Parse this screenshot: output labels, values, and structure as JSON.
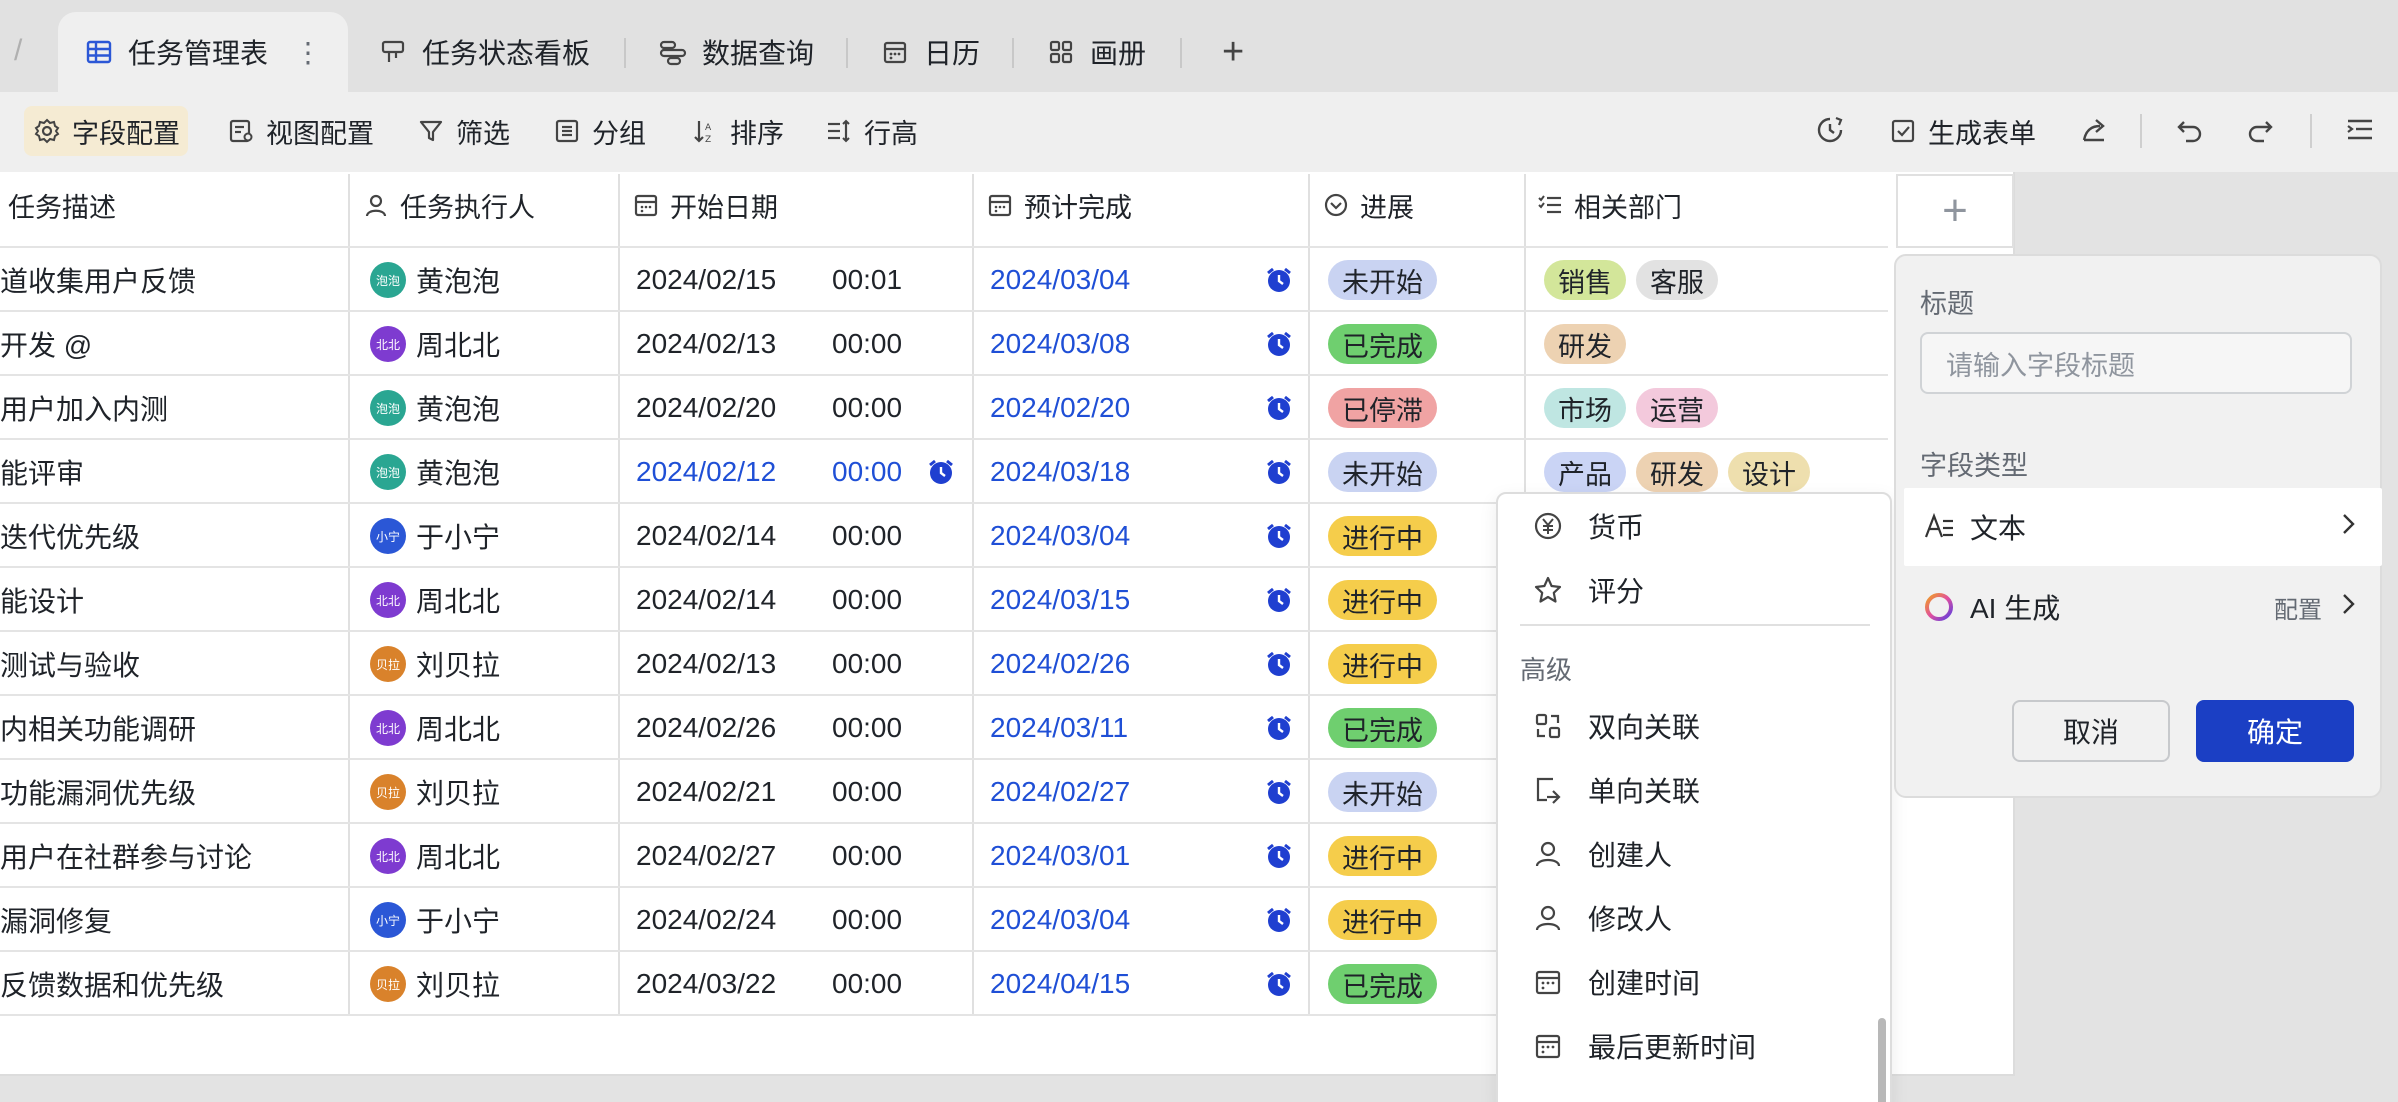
{
  "tabs": {
    "active": "任务管理表",
    "items": [
      "任务状态看板",
      "数据查询",
      "日历",
      "画册"
    ]
  },
  "toolbar": {
    "items": [
      "字段配置",
      "视图配置",
      "筛选",
      "分组",
      "排序",
      "行高"
    ],
    "generate_form": "生成表单"
  },
  "columns": [
    "任务描述",
    "任务执行人",
    "开始日期",
    "预计完成",
    "进展",
    "相关部门"
  ],
  "rows": [
    {
      "desc": "道收集用户反馈",
      "avatar": "泡泡",
      "avatar_color": "#2aa692",
      "person": "黄泡泡",
      "start_date": "2024/02/15",
      "start_time": "00:01",
      "due": "2024/03/04",
      "status": "未开始",
      "depts": [
        "销售",
        "客服"
      ]
    },
    {
      "desc": "开发 @",
      "avatar": "北北",
      "avatar_color": "#7e3bd0",
      "person": "周北北",
      "start_date": "2024/02/13",
      "start_time": "00:00",
      "due": "2024/03/08",
      "status": "已完成",
      "depts": [
        "研发"
      ]
    },
    {
      "desc": "用户加入内测",
      "avatar": "泡泡",
      "avatar_color": "#2aa692",
      "person": "黄泡泡",
      "start_date": "2024/02/20",
      "start_time": "00:00",
      "due": "2024/02/20",
      "status": "已停滞",
      "depts": [
        "市场",
        "运营"
      ]
    },
    {
      "desc": "能评审",
      "avatar": "泡泡",
      "avatar_color": "#2aa692",
      "person": "黄泡泡",
      "start_date": "2024/02/12",
      "start_time": "00:00",
      "due": "2024/03/18",
      "status": "未开始",
      "depts": [
        "产品",
        "研发",
        "设计"
      ]
    },
    {
      "desc": "迭代优先级",
      "avatar": "小宁",
      "avatar_color": "#2b57d6",
      "person": "于小宁",
      "start_date": "2024/02/14",
      "start_time": "00:00",
      "due": "2024/03/04",
      "status": "进行中",
      "depts": []
    },
    {
      "desc": "能设计",
      "avatar": "北北",
      "avatar_color": "#7e3bd0",
      "person": "周北北",
      "start_date": "2024/02/14",
      "start_time": "00:00",
      "due": "2024/03/15",
      "status": "进行中",
      "depts": []
    },
    {
      "desc": "测试与验收",
      "avatar": "贝拉",
      "avatar_color": "#d9822b",
      "person": "刘贝拉",
      "start_date": "2024/02/13",
      "start_time": "00:00",
      "due": "2024/02/26",
      "status": "进行中",
      "depts": []
    },
    {
      "desc": "内相关功能调研",
      "avatar": "北北",
      "avatar_color": "#7e3bd0",
      "person": "周北北",
      "start_date": "2024/02/26",
      "start_time": "00:00",
      "due": "2024/03/11",
      "status": "已完成",
      "depts": []
    },
    {
      "desc": "功能漏洞优先级",
      "avatar": "贝拉",
      "avatar_color": "#d9822b",
      "person": "刘贝拉",
      "start_date": "2024/02/21",
      "start_time": "00:00",
      "due": "2024/02/27",
      "status": "未开始",
      "depts": []
    },
    {
      "desc": "用户在社群参与讨论",
      "avatar": "北北",
      "avatar_color": "#7e3bd0",
      "person": "周北北",
      "start_date": "2024/02/27",
      "start_time": "00:00",
      "due": "2024/03/01",
      "status": "进行中",
      "depts": []
    },
    {
      "desc": "漏洞修复",
      "avatar": "小宁",
      "avatar_color": "#2b57d6",
      "person": "于小宁",
      "start_date": "2024/02/24",
      "start_time": "00:00",
      "due": "2024/03/04",
      "status": "进行中",
      "depts": []
    },
    {
      "desc": "反馈数据和优先级",
      "avatar": "贝拉",
      "avatar_color": "#d9822b",
      "person": "刘贝拉",
      "start_date": "2024/03/22",
      "start_time": "00:00",
      "due": "2024/04/15",
      "status": "已完成",
      "depts": []
    }
  ],
  "status_colors": {
    "未开始": "#c9d3f2",
    "已完成": "#6fcf6f",
    "已停滞": "#f0a3a3",
    "进行中": "#f5cd4b"
  },
  "dept_colors": {
    "销售": "#d3e69a",
    "客服": "#e2e2e2",
    "研发": "#edd2b2",
    "市场": "#bfe6e2",
    "运营": "#f3c9dc",
    "产品": "#cad4f5",
    "设计": "#eedfae"
  },
  "field_menu": {
    "items_top": [
      "货币",
      "评分"
    ],
    "group_label": "高级",
    "items_advanced": [
      "双向关联",
      "单向关联",
      "创建人",
      "修改人",
      "创建时间",
      "最后更新时间"
    ]
  },
  "field_panel": {
    "title_label": "标题",
    "title_placeholder": "请输入字段标题",
    "type_label": "字段类型",
    "type_selected": "文本",
    "ai_label": "AI 生成",
    "ai_config": "配置",
    "cancel": "取消",
    "confirm": "确定"
  }
}
